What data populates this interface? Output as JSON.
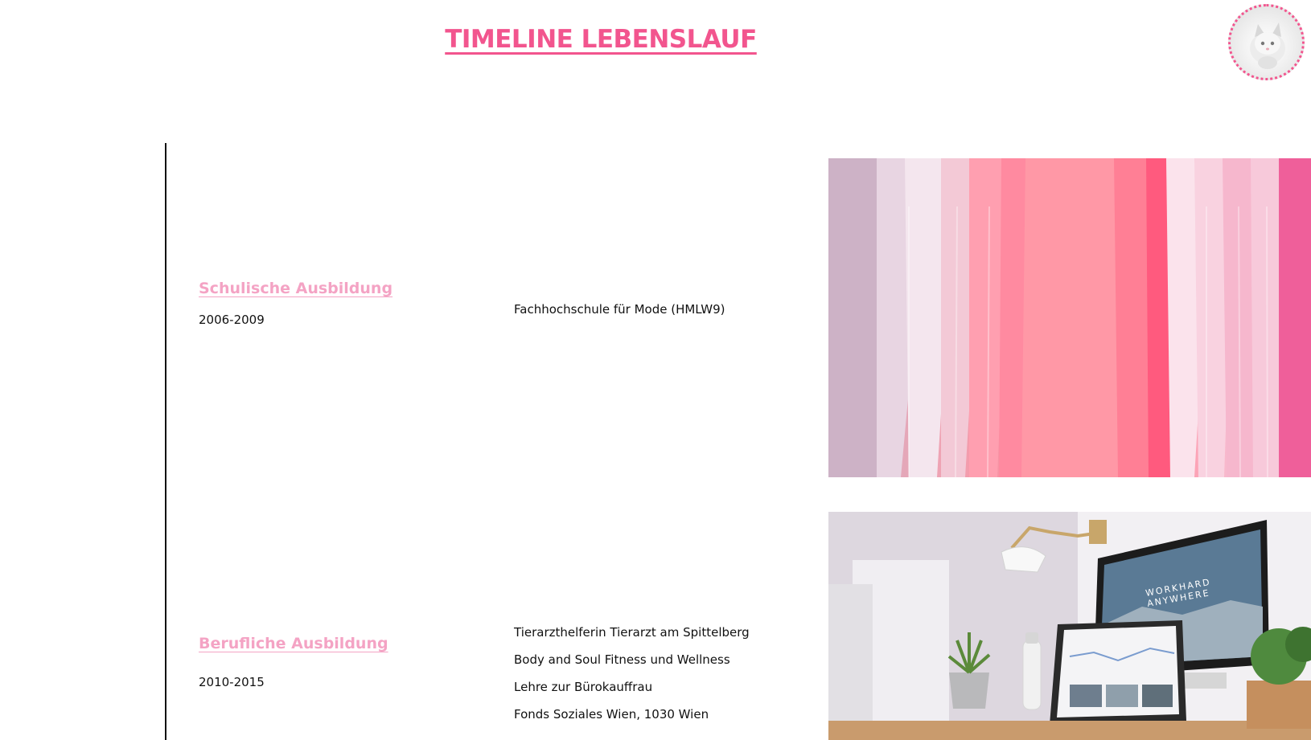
{
  "page": {
    "title": "TIMELINE LEBENSLAUF",
    "accent_color": "#f2558e",
    "heading_color": "#f4a3c4"
  },
  "avatar": {
    "icon": "kitten-avatar-icon"
  },
  "sections": [
    {
      "heading": "Schulische Ausbildung",
      "years": "2006-2009",
      "details": [
        "Fachhochschule für Mode (HMLW9)"
      ],
      "image": "pink-t-shirts-on-rack-photo"
    },
    {
      "heading": "Berufliche Ausbildung",
      "years": "2010-2015",
      "details": [
        "Tierarzthelferin Tierarzt am Spittelberg",
        "Body and Soul Fitness und Wellness",
        "Lehre zur Bürokauffrau",
        "Fonds Soziales Wien, 1030 Wien"
      ],
      "image": "desk-with-computer-photo",
      "monitor_text": [
        "WORKHARD",
        "ANYWHERE"
      ]
    }
  ]
}
